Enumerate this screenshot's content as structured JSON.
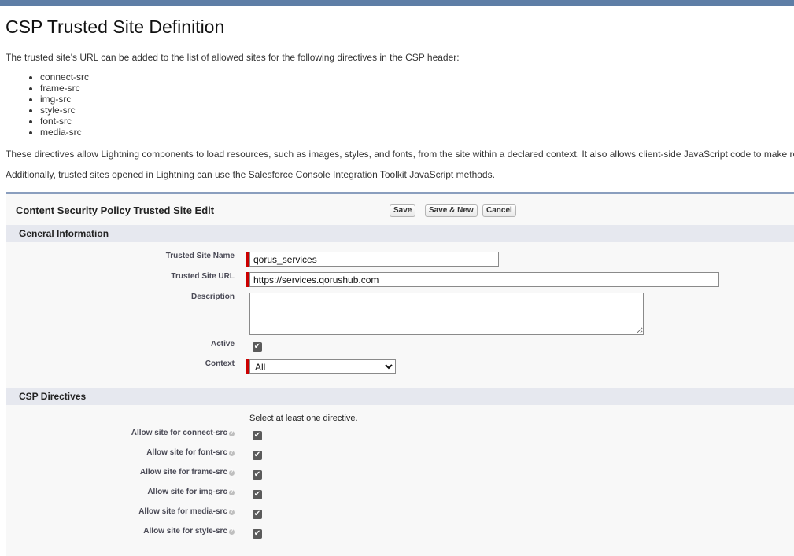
{
  "page": {
    "title": "CSP Trusted Site Definition",
    "intro": "The trusted site's URL can be added to the list of allowed sites for the following directives in the CSP header:",
    "directives": [
      "connect-src",
      "frame-src",
      "img-src",
      "style-src",
      "font-src",
      "media-src"
    ],
    "para2": "These directives allow Lightning components to load resources, such as images, styles, and fonts, from the site within a declared context. It also allows client-side JavaScript code to make requests to the site.",
    "para3_prefix": "Additionally, trusted sites opened in Lightning can use the ",
    "para3_link": "Salesforce Console Integration Toolkit",
    "para3_suffix": " JavaScript methods."
  },
  "panel": {
    "title": "Content Security Policy Trusted Site Edit",
    "buttons": {
      "save": "Save",
      "save_new": "Save & New",
      "cancel": "Cancel"
    }
  },
  "general": {
    "section_title": "General Information",
    "name_label": "Trusted Site Name",
    "name_value": "qorus_services",
    "url_label": "Trusted Site URL",
    "url_value": "https://services.qorushub.com",
    "description_label": "Description",
    "description_value": "",
    "active_label": "Active",
    "active_checked": true,
    "context_label": "Context",
    "context_value": "All"
  },
  "csp": {
    "section_title": "CSP Directives",
    "hint": "Select at least one directive.",
    "items": [
      {
        "label": "Allow site for connect-src",
        "checked": true
      },
      {
        "label": "Allow site for font-src",
        "checked": true
      },
      {
        "label": "Allow site for frame-src",
        "checked": true
      },
      {
        "label": "Allow site for img-src",
        "checked": true
      },
      {
        "label": "Allow site for media-src",
        "checked": true
      },
      {
        "label": "Allow site for style-src",
        "checked": true
      }
    ]
  },
  "colors": {
    "header_band": "#5e7ea6",
    "panel_border": "#8a9ebe",
    "section_bar": "#e6e8ef",
    "required": "#cc0000"
  }
}
